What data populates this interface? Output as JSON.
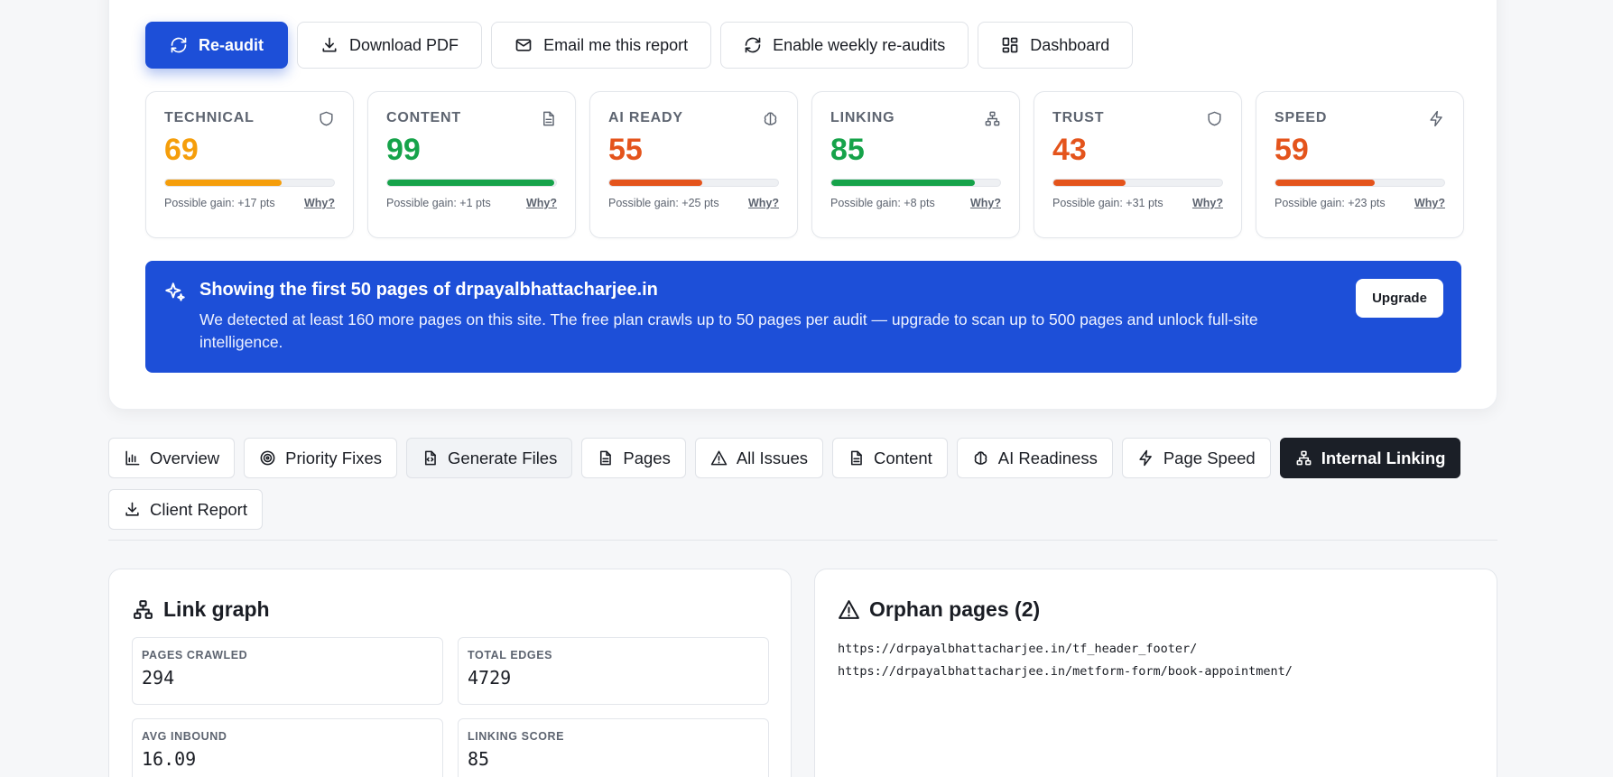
{
  "actions": {
    "reaudit": "Re-audit",
    "download_pdf": "Download PDF",
    "email_report": "Email me this report",
    "weekly": "Enable weekly re-audits",
    "dashboard": "Dashboard"
  },
  "scores": [
    {
      "label": "TECHNICAL",
      "value": "69",
      "progress": 0.69,
      "color": "#f59e0b",
      "gain": "Possible gain: +17 pts",
      "why": "Why?",
      "icon": "shield-icon"
    },
    {
      "label": "CONTENT",
      "value": "99",
      "progress": 0.99,
      "color": "#16a34a",
      "gain": "Possible gain: +1 pts",
      "why": "Why?",
      "icon": "document-icon"
    },
    {
      "label": "AI READY",
      "value": "55",
      "progress": 0.55,
      "color": "#e4541c",
      "gain": "Possible gain: +25 pts",
      "why": "Why?",
      "icon": "brain-icon"
    },
    {
      "label": "LINKING",
      "value": "85",
      "progress": 0.85,
      "color": "#16a34a",
      "gain": "Possible gain: +8 pts",
      "why": "Why?",
      "icon": "network-icon"
    },
    {
      "label": "TRUST",
      "value": "43",
      "progress": 0.43,
      "color": "#e4541c",
      "gain": "Possible gain: +31 pts",
      "why": "Why?",
      "icon": "shield-icon"
    },
    {
      "label": "SPEED",
      "value": "59",
      "progress": 0.59,
      "color": "#e4541c",
      "gain": "Possible gain: +23 pts",
      "why": "Why?",
      "icon": "lightning-icon"
    }
  ],
  "banner": {
    "title": "Showing the first 50 pages of drpayalbhattacharjee.in",
    "text": "We detected at least 160 more pages on this site. The free plan crawls up to 50 pages per audit — upgrade to scan up to 500 pages and unlock full-site intelligence.",
    "button": "Upgrade",
    "color": "#1d4fd8"
  },
  "tabs": [
    {
      "label": "Overview"
    },
    {
      "label": "Priority Fixes"
    },
    {
      "label": "Generate Files"
    },
    {
      "label": "Pages"
    },
    {
      "label": "All Issues"
    },
    {
      "label": "Content"
    },
    {
      "label": "AI Readiness"
    },
    {
      "label": "Page Speed"
    },
    {
      "label": "Internal Linking",
      "active": true
    },
    {
      "label": "Client Report"
    }
  ],
  "link_graph": {
    "title": "Link graph",
    "stats": [
      {
        "label": "PAGES CRAWLED",
        "value": "294"
      },
      {
        "label": "TOTAL EDGES",
        "value": "4729"
      },
      {
        "label": "AVG INBOUND",
        "value": "16.09"
      },
      {
        "label": "LINKING SCORE",
        "value": "85"
      }
    ]
  },
  "orphans": {
    "title": "Orphan pages (2)",
    "urls": [
      "https://drpayalbhattacharjee.in/tf_header_footer/",
      "https://drpayalbhattacharjee.in/metform-form/book-appointment/"
    ]
  }
}
